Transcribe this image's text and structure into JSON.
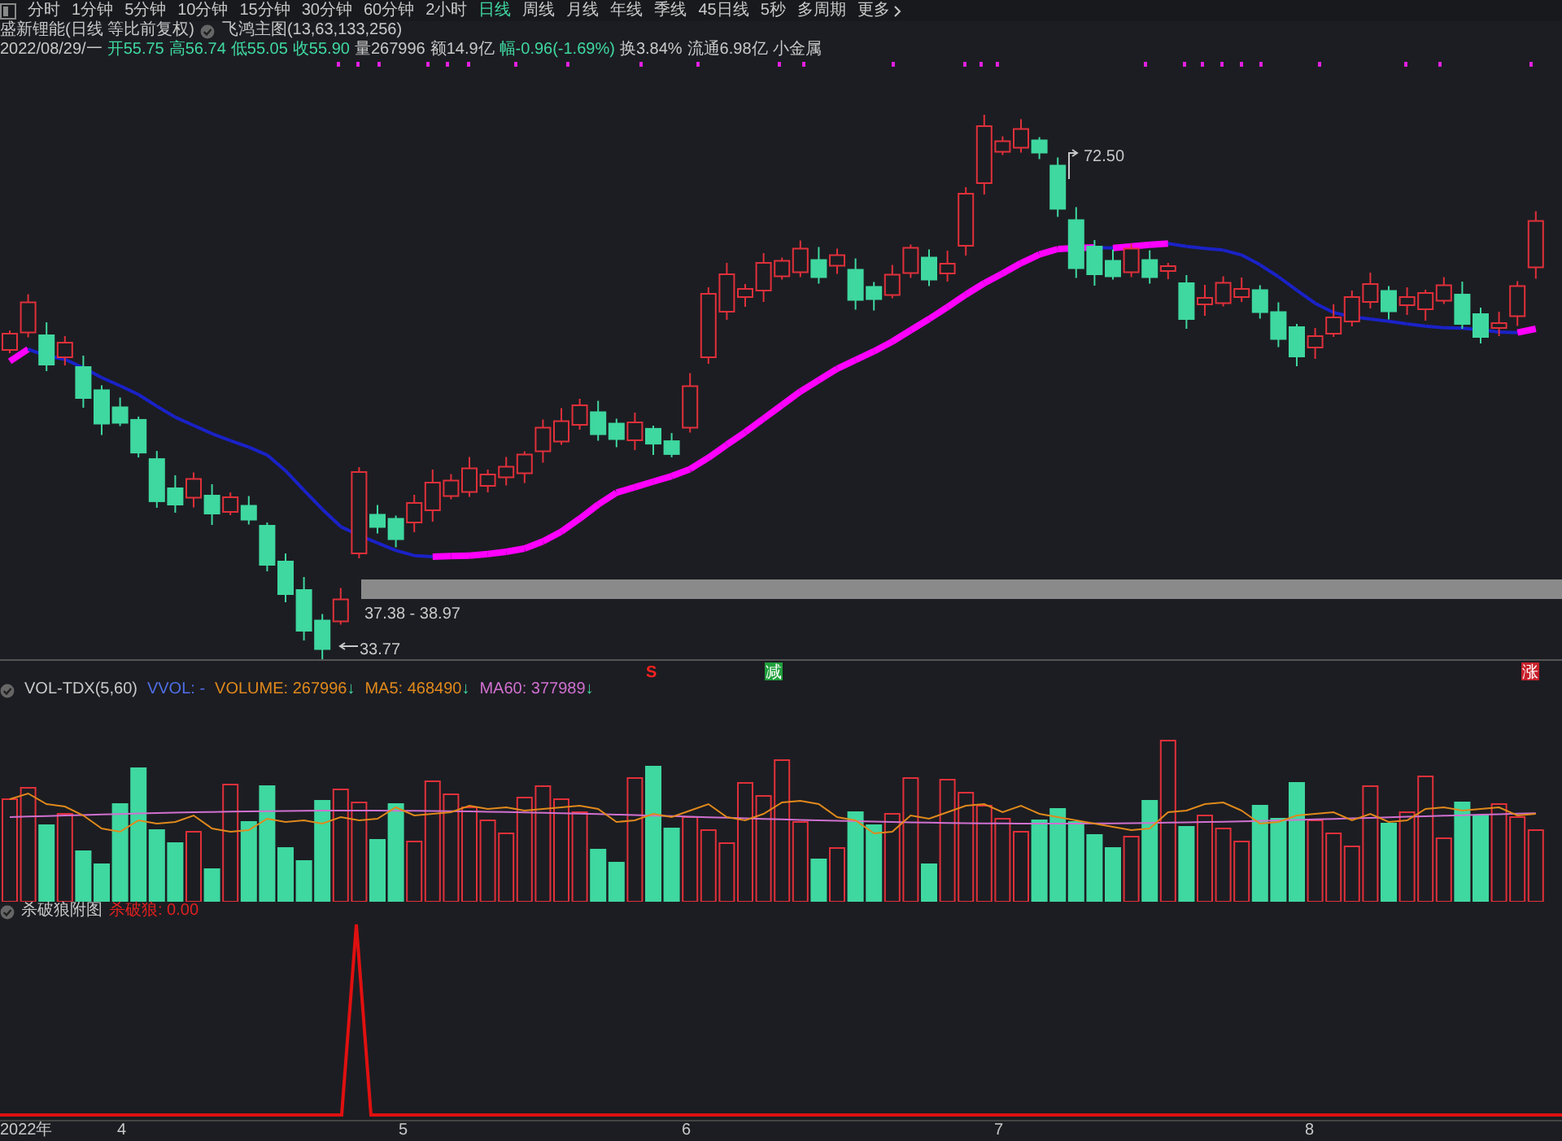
{
  "toolbar": {
    "tabs": [
      {
        "label": "分时",
        "selected": false
      },
      {
        "label": "1分钟",
        "selected": false
      },
      {
        "label": "5分钟",
        "selected": false
      },
      {
        "label": "10分钟",
        "selected": false
      },
      {
        "label": "15分钟",
        "selected": false
      },
      {
        "label": "30分钟",
        "selected": false
      },
      {
        "label": "60分钟",
        "selected": false
      },
      {
        "label": "2小时",
        "selected": false
      },
      {
        "label": "日线",
        "selected": true
      },
      {
        "label": "周线",
        "selected": false
      },
      {
        "label": "月线",
        "selected": false
      },
      {
        "label": "年线",
        "selected": false
      },
      {
        "label": "季线",
        "selected": false
      },
      {
        "label": "45日线",
        "selected": false
      },
      {
        "label": "5秒",
        "selected": false
      },
      {
        "label": "多周期",
        "selected": false
      }
    ],
    "more": "更多"
  },
  "title": {
    "name": "盛新锂能(日线 等比前复权)",
    "indicator": "飞鸿主图(13,63,133,256)"
  },
  "quote": [
    {
      "text": "2022/08/29/一",
      "color": "#c8c8c8"
    },
    {
      "text": "开55.75",
      "color": "#3fd8a0"
    },
    {
      "text": "高56.74",
      "color": "#3fd8a0"
    },
    {
      "text": "低55.05",
      "color": "#3fd8a0"
    },
    {
      "text": "收55.90",
      "color": "#3fd8a0"
    },
    {
      "text": "量267996",
      "color": "#c8c8c8"
    },
    {
      "text": "额14.9亿",
      "color": "#c8c8c8"
    },
    {
      "text": "幅-0.96(-1.69%)",
      "color": "#3fd8a0"
    },
    {
      "text": "换3.84%",
      "color": "#c8c8c8"
    },
    {
      "text": "流通6.98亿",
      "color": "#c8c8c8"
    },
    {
      "text": "小金属",
      "color": "#c8c8c8"
    }
  ],
  "main_chart": {
    "high_label": "72.50",
    "low_label": "33.77",
    "band_label": "37.38 - 38.97"
  },
  "signals": [
    {
      "text": "S",
      "kind": "plain",
      "color": "#ff2020"
    },
    {
      "text": "减",
      "kind": "boxed",
      "color": "#1f9e3a"
    },
    {
      "text": "涨",
      "kind": "boxed",
      "color": "#c8202a"
    }
  ],
  "volume_panel": {
    "name": "VOL-TDX(5,60)",
    "items": [
      {
        "text": "VVOL: -",
        "color": "#4f6fe8"
      },
      {
        "text": "VOLUME: 267996",
        "color": "#e0891c",
        "trend": "↓"
      },
      {
        "text": "MA5: 468490",
        "color": "#e0891c",
        "trend": "↓"
      },
      {
        "text": "MA60: 377989",
        "color": "#d070d0",
        "trend": "↓"
      }
    ]
  },
  "indicator_panel": {
    "name": "杀破狼附图",
    "reading": "杀破狼: 0.00"
  },
  "x_axis": [
    "2022年",
    "4",
    "5",
    "6",
    "7",
    "8"
  ]
}
